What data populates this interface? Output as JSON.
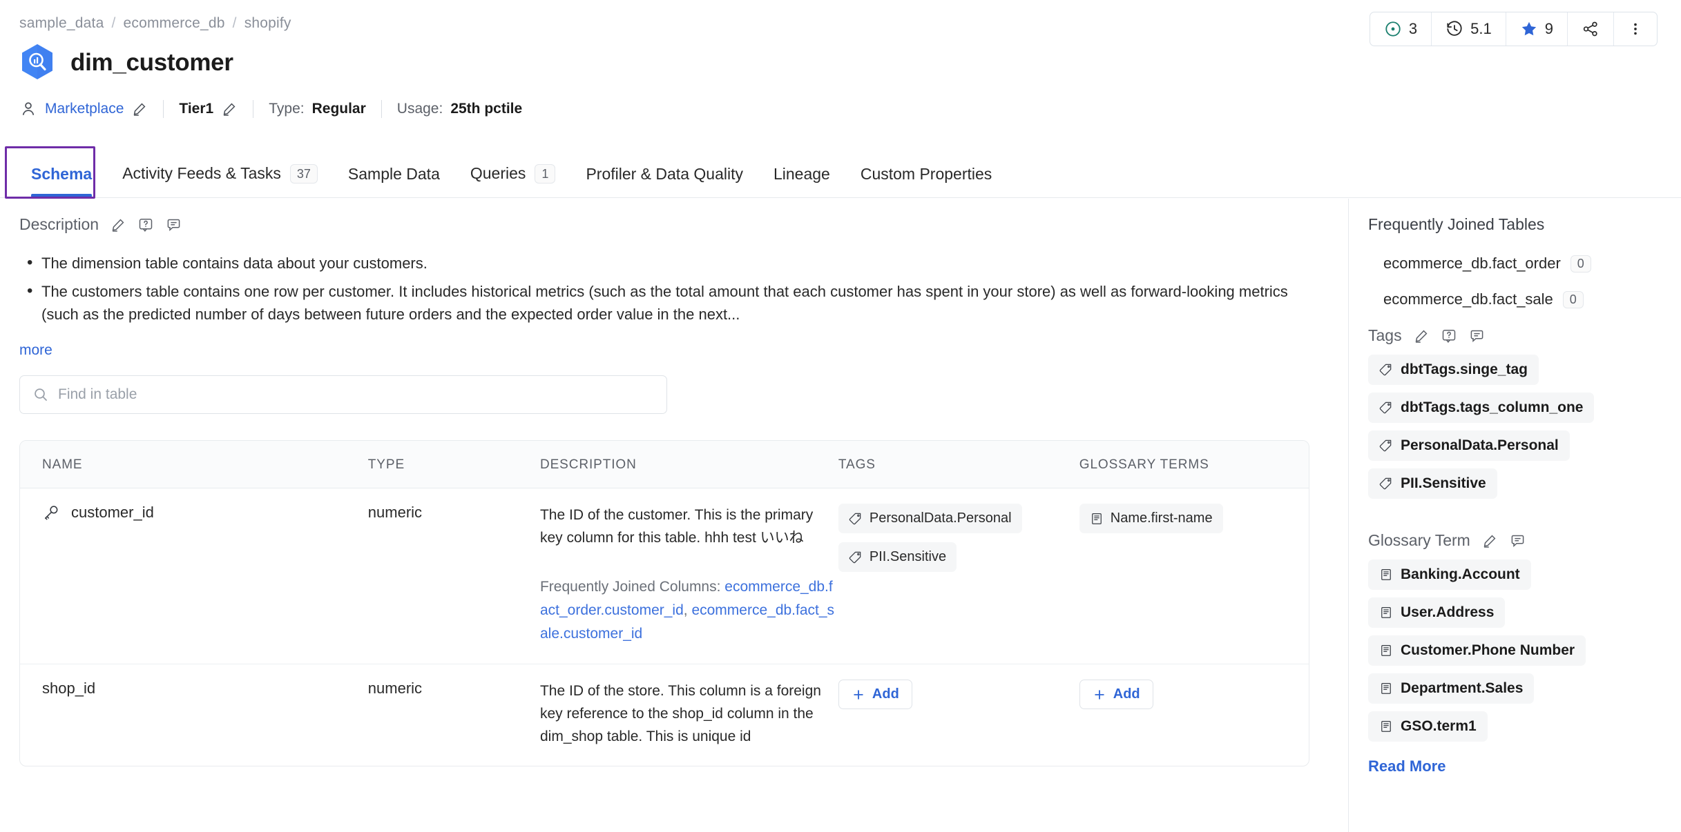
{
  "breadcrumb": [
    "sample_data",
    "ecommerce_db",
    "shopify"
  ],
  "header": {
    "title": "dim_customer",
    "owner_label": "Marketplace",
    "tier": "Tier1",
    "type_label": "Type:",
    "type_value": "Regular",
    "usage_label": "Usage:",
    "usage_value": "25th pctile"
  },
  "top_actions": {
    "votes": "3",
    "version": "5.1",
    "followers": "9"
  },
  "tabs": [
    {
      "label": "Schema",
      "badge": "",
      "active": true
    },
    {
      "label": "Activity Feeds & Tasks",
      "badge": "37",
      "active": false
    },
    {
      "label": "Sample Data",
      "badge": "",
      "active": false
    },
    {
      "label": "Queries",
      "badge": "1",
      "active": false
    },
    {
      "label": "Profiler & Data Quality",
      "badge": "",
      "active": false
    },
    {
      "label": "Lineage",
      "badge": "",
      "active": false
    },
    {
      "label": "Custom Properties",
      "badge": "",
      "active": false
    }
  ],
  "description": {
    "title": "Description",
    "bullets": [
      "The dimension table contains data about your customers.",
      "The customers table contains one row per customer. It includes historical metrics (such as the total amount that each customer has spent in your store) as well as forward-looking metrics (such as the predicted number of days between future orders and the expected order value in the next..."
    ],
    "more_label": "more"
  },
  "search": {
    "placeholder": "Find in table",
    "value": ""
  },
  "table": {
    "columns": [
      "NAME",
      "TYPE",
      "DESCRIPTION",
      "TAGS",
      "GLOSSARY TERMS"
    ],
    "rows": [
      {
        "name": "customer_id",
        "type": "numeric",
        "description": "The ID of the customer. This is the primary key column for this table. hhh test   いいね",
        "frequently_joined_label": "Frequently Joined Columns:",
        "frequently_joined_links": [
          "ecommerce_db.fact_order.customer_id",
          "ecommerce_db.fact_sale.customer_id"
        ],
        "tags": [
          "PersonalData.Personal",
          "PII.Sensitive"
        ],
        "glossary": [
          "Name.first-name"
        ],
        "add_tag_label": "",
        "add_glossary_label": ""
      },
      {
        "name": "shop_id",
        "type": "numeric",
        "description": "The ID of the store. This column is a foreign key reference to the shop_id column in the dim_shop table. This is unique id",
        "frequently_joined_label": "",
        "frequently_joined_links": [],
        "tags": [],
        "glossary": [],
        "add_tag_label": "Add",
        "add_glossary_label": "Add"
      }
    ]
  },
  "sidebar": {
    "frequently_joined_title": "Frequently Joined Tables",
    "joined_tables": [
      {
        "name": "ecommerce_db.fact_order",
        "count": "0"
      },
      {
        "name": "ecommerce_db.fact_sale",
        "count": "0"
      }
    ],
    "tags_title": "Tags",
    "tags": [
      "dbtTags.singe_tag",
      "dbtTags.tags_column_one",
      "PersonalData.Personal",
      "PII.Sensitive"
    ],
    "glossary_title": "Glossary Term",
    "glossary_terms": [
      "Banking.Account",
      "User.Address",
      "Customer.Phone Number",
      "Department.Sales",
      "GSO.term1"
    ],
    "read_more_label": "Read More"
  },
  "icons": {
    "breadcrumb_sep": "/",
    "service": "bigquery-hexagon-icon",
    "owner": "team-icon",
    "edit": "pencil-icon",
    "request": "question-box-icon",
    "comment": "chat-icon",
    "vote": "thumbs-up-circle-icon",
    "version": "history-clock-icon",
    "follow": "star-icon",
    "share": "share-icon",
    "more": "kebab-menu-icon",
    "search": "search-icon",
    "key": "primary-key-icon",
    "tag": "tag-icon",
    "glossary": "book-icon",
    "plus": "plus-icon"
  },
  "colors": {
    "accent": "#2f65d6",
    "focus": "#6f2da8",
    "muted": "#5c6068",
    "chip_bg": "#f5f6f7"
  }
}
